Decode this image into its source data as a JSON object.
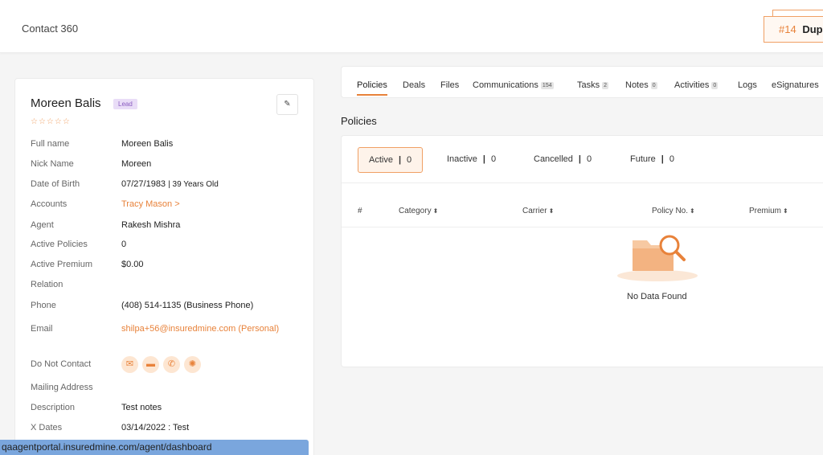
{
  "header": {
    "title": "Contact 360",
    "dup_number": "#14",
    "dup_label": "Dupl"
  },
  "contact": {
    "name": "Moreen Balis",
    "badge": "Lead",
    "stars": "☆☆☆☆☆",
    "fields": {
      "full_name": {
        "label": "Full name",
        "value": "Moreen Balis"
      },
      "nick_name": {
        "label": "Nick Name",
        "value": "Moreen"
      },
      "dob": {
        "label": "Date of Birth",
        "value": "07/27/1983",
        "age": "| 39 Years Old"
      },
      "accounts": {
        "label": "Accounts",
        "value": "Tracy Mason >"
      },
      "agent": {
        "label": "Agent",
        "value": "Rakesh Mishra"
      },
      "active_policies": {
        "label": "Active Policies",
        "value": "0"
      },
      "active_premium": {
        "label": "Active Premium",
        "value": "$0.00"
      },
      "relation": {
        "label": "Relation",
        "value": ""
      },
      "phone": {
        "label": "Phone",
        "value": "(408) 514-1135 (Business Phone)"
      },
      "email": {
        "label": "Email",
        "value": "shilpa+56@insuredmine.com  (Personal)"
      },
      "do_not_contact": {
        "label": "Do Not Contact"
      },
      "mailing_address": {
        "label": "Mailing Address",
        "value": ""
      },
      "description": {
        "label": "Description",
        "value": "Test notes"
      },
      "x_dates": {
        "label": "X Dates",
        "value": "03/14/2022 : Test"
      }
    }
  },
  "tabs": [
    {
      "label": "Policies",
      "count": ""
    },
    {
      "label": "Deals",
      "count": ""
    },
    {
      "label": "Files",
      "count": ""
    },
    {
      "label": "Communications",
      "count": "154"
    },
    {
      "label": "Tasks",
      "count": "2"
    },
    {
      "label": "Notes",
      "count": "0"
    },
    {
      "label": "Activities",
      "count": "0"
    },
    {
      "label": "Logs",
      "count": ""
    },
    {
      "label": "eSignatures",
      "count": ""
    }
  ],
  "policies": {
    "title": "Policies",
    "filters": [
      {
        "label": "Active",
        "count": "0"
      },
      {
        "label": "Inactive",
        "count": "0"
      },
      {
        "label": "Cancelled",
        "count": "0"
      },
      {
        "label": "Future",
        "count": "0"
      }
    ],
    "columns": [
      "#",
      "Category",
      "Carrier",
      "Policy No.",
      "Premium"
    ],
    "sort_icon": "⬍",
    "empty_text": "No Data Found"
  },
  "statusbar": {
    "url": "qaagentportal.insuredmine.com/agent/dashboard"
  },
  "colors": {
    "accent": "#e8823a",
    "lead_badge_bg": "#e9ddf7",
    "statusbar_bg": "#7aa6dd"
  }
}
